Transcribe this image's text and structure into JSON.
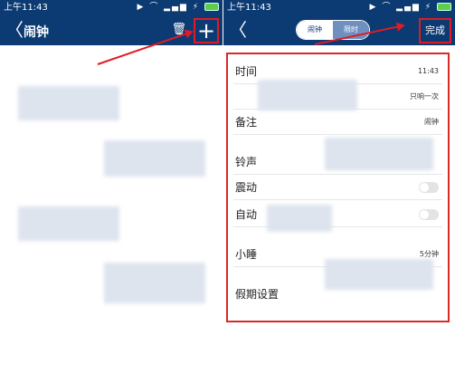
{
  "left": {
    "status_time": "上午11:43",
    "status_icons": "▶ ⌒ ▂▄▆ ⚡",
    "back_glyph": "〈",
    "title": "闹钟",
    "trash_glyph": "🗑",
    "add_glyph": "+"
  },
  "right": {
    "status_time": "上午11:43",
    "status_icons": "▶ ⌒ ▂▄▆ ⚡",
    "back_glyph": "〈",
    "segment_left": "闹钟",
    "segment_right": "限时",
    "done_label": "完成",
    "rows": [
      {
        "label": "时间",
        "value": "11:43"
      },
      {
        "label": "",
        "value": "只响一次"
      },
      {
        "label": "备注",
        "value": "闹钟"
      },
      {
        "label": "铃声",
        "value": ""
      },
      {
        "label": "震动",
        "value": ""
      },
      {
        "label": "自动",
        "value": ""
      },
      {
        "label": "小睡",
        "value": "5分钟"
      },
      {
        "label": "假期设置",
        "value": ""
      }
    ]
  },
  "colors": {
    "header": "#0c3a72",
    "highlight": "#e01b24"
  }
}
